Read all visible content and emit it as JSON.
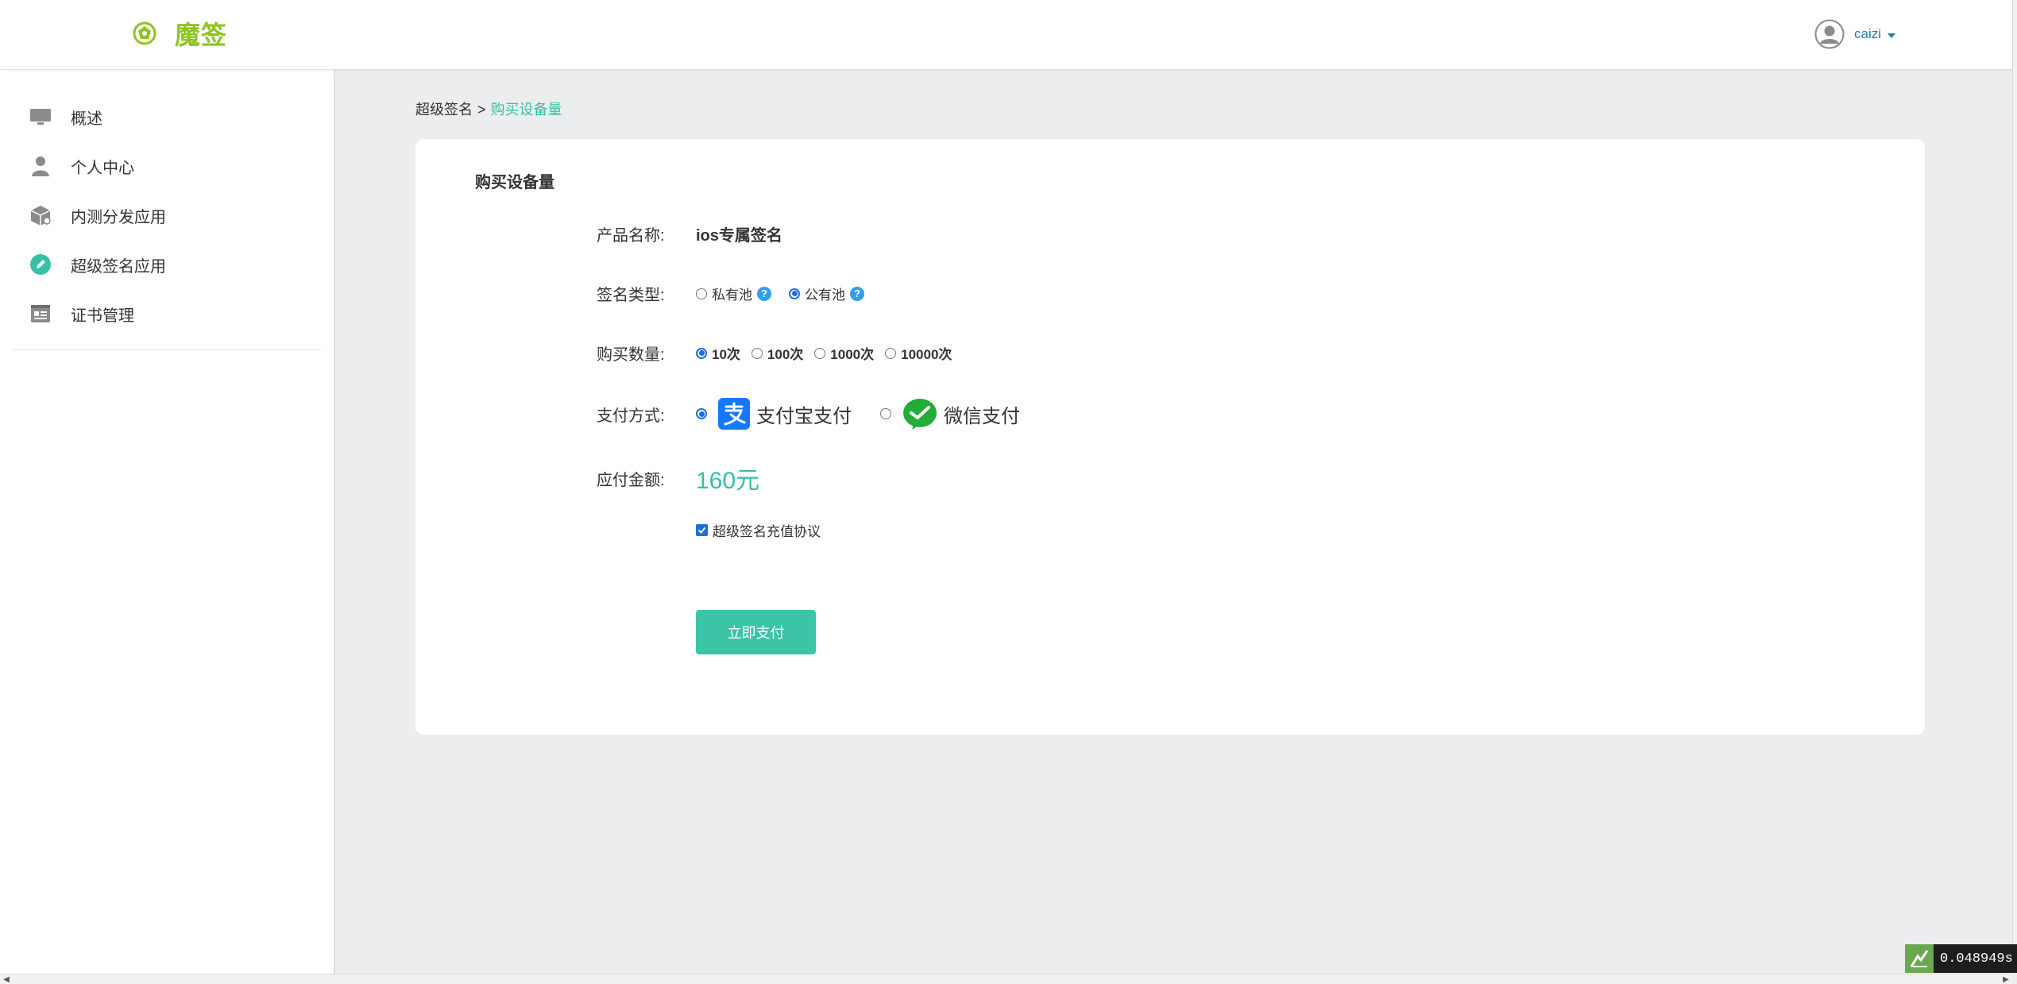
{
  "header": {
    "brand": "魔签",
    "user": {
      "name": "caizi"
    }
  },
  "sidebar": {
    "items": [
      {
        "label": "概述",
        "icon": "monitor-icon"
      },
      {
        "label": "个人中心",
        "icon": "user-icon"
      },
      {
        "label": "内测分发应用",
        "icon": "package-icon"
      },
      {
        "label": "超级签名应用",
        "icon": "pencil-icon"
      },
      {
        "label": "证书管理",
        "icon": "id-card-icon"
      }
    ]
  },
  "breadcrumb": {
    "parent": "超级签名",
    "separator": ">",
    "current": "购买设备量"
  },
  "form": {
    "title": "购买设备量",
    "product": {
      "label": "产品名称:",
      "value": "ios专属签名"
    },
    "sign_type": {
      "label": "签名类型:",
      "options": [
        {
          "label": "私有池",
          "checked": false,
          "help": "?"
        },
        {
          "label": "公有池",
          "checked": true,
          "help": "?"
        }
      ]
    },
    "quantity": {
      "label": "购买数量:",
      "options": [
        {
          "label": "10次",
          "checked": true
        },
        {
          "label": "100次",
          "checked": false
        },
        {
          "label": "1000次",
          "checked": false
        },
        {
          "label": "10000次",
          "checked": false
        }
      ]
    },
    "payment": {
      "label": "支付方式:",
      "options": [
        {
          "label": "支付宝支付",
          "checked": true,
          "icon": "alipay-icon"
        },
        {
          "label": "微信支付",
          "checked": false,
          "icon": "wechat-pay-icon"
        }
      ]
    },
    "amount": {
      "label": "应付金额:",
      "value": "160元"
    },
    "agreement": {
      "label": "超级签名充值协议",
      "checked": true
    },
    "submit_label": "立即支付"
  },
  "perf": {
    "value": "0.048949s"
  },
  "colors": {
    "accent": "#34c1a5",
    "brand": "#8fc31f",
    "link": "#1e7bb8",
    "radio": "#1f6fd8"
  }
}
